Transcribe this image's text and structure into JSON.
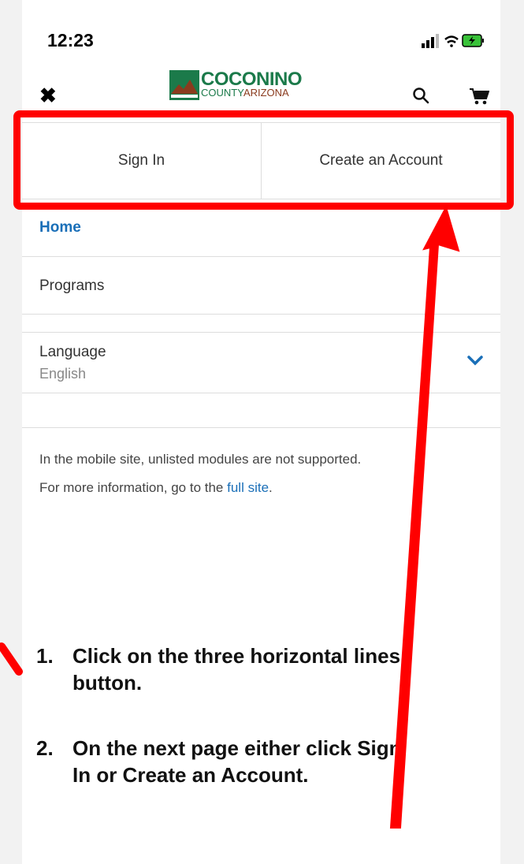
{
  "status_bar": {
    "time": "12:23"
  },
  "header": {
    "close_icon": "close-icon",
    "logo_line1": "COCONINO",
    "logo_line2_a": "COUNTY",
    "logo_line2_b": "ARIZONA"
  },
  "auth": {
    "sign_in": "Sign In",
    "create_account": "Create an Account"
  },
  "menu": {
    "home": "Home",
    "programs": "Programs",
    "language_label": "Language",
    "language_value": "English"
  },
  "info": {
    "line1": "In the mobile site, unlisted modules are not supported.",
    "line2_prefix": "For more information, go to the ",
    "line2_link": "full site",
    "line2_suffix": "."
  },
  "instructions": [
    {
      "num": "1.",
      "text": "Click on the three horizontal lines button."
    },
    {
      "num": "2.",
      "text": "On the next page either click Sign In or Create an Account."
    }
  ],
  "colors": {
    "accent": "#1a6fb8",
    "highlight": "#ff0000",
    "logo_green": "#1b7a4a",
    "logo_brown": "#8a3b1e"
  }
}
